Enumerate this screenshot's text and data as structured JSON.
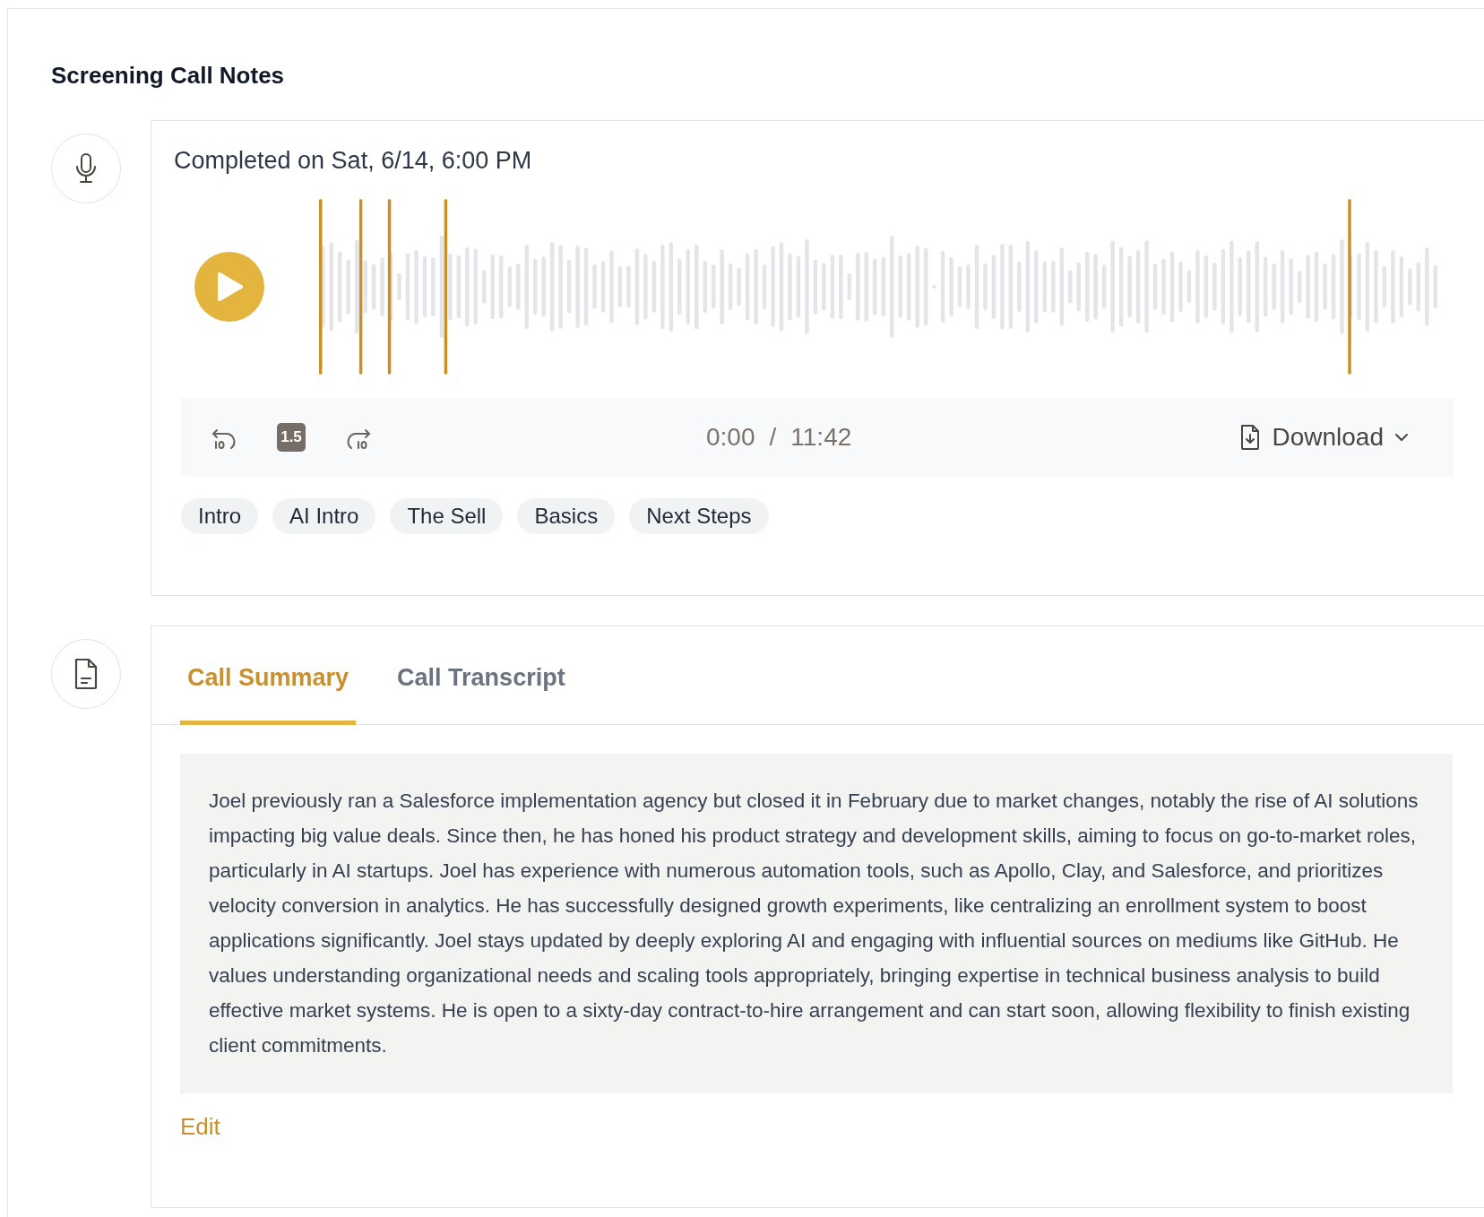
{
  "title": "Screening Call Notes",
  "recording": {
    "completed": "Completed on Sat, 6/14, 6:00 PM",
    "speed": "1.5",
    "current_time": "0:00",
    "separator": "/",
    "duration": "11:42",
    "download": "Download",
    "chapters": [
      "Intro",
      "AI Intro",
      "The Sell",
      "Basics",
      "Next Steps"
    ]
  },
  "notes": {
    "tabs": [
      {
        "label": "Call Summary",
        "selected": true
      },
      {
        "label": "Call Transcript",
        "selected": false
      }
    ],
    "summary": "Joel previously ran a Salesforce implementation agency but closed it in February due to market changes, notably the rise of AI solutions impacting big value deals. Since then, he has honed his product strategy and development skills, aiming to focus on go-to-market roles, particularly in AI startups. Joel has experience with numerous automation tools, such as Apollo, Clay, and Salesforce, and prioritizes velocity conversion in analytics. He has successfully designed growth experiments, like centralizing an enrollment system to boost applications significantly. Joel stays updated by deeply exploring AI and engaging with influential sources on mediums like GitHub. He values understanding organizational needs and scaling tools appropriately, bringing expertise in technical business analysis to build effective market systems. He is open to a sixty-day contract-to-hire arrangement and can start soon, allowing flexibility to finish existing client commitments.",
    "edit": "Edit"
  }
}
